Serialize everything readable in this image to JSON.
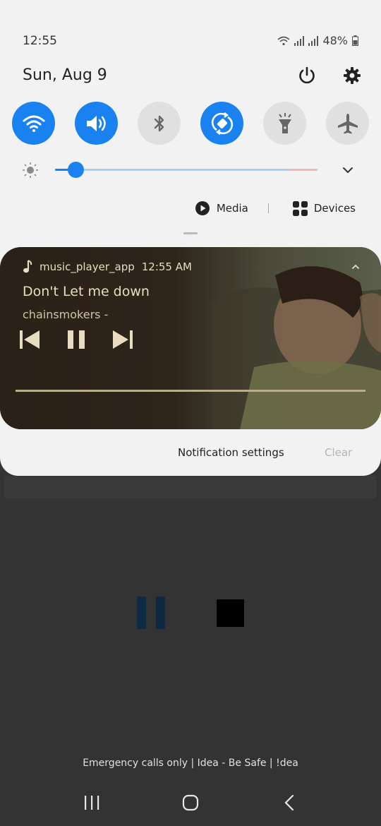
{
  "status_bar": {
    "time": "12:55",
    "battery": "48%",
    "icons": [
      "wifi-icon",
      "signal-icon",
      "signal-icon",
      "battery-icon"
    ]
  },
  "header": {
    "date": "Sun, Aug 9",
    "power_icon": "power-icon",
    "settings_icon": "gear-icon"
  },
  "quick_toggles": [
    {
      "name": "wifi",
      "icon": "wifi-icon",
      "on": true
    },
    {
      "name": "sound",
      "icon": "speaker-icon",
      "on": true
    },
    {
      "name": "bluetooth",
      "icon": "bluetooth-icon",
      "on": false
    },
    {
      "name": "auto-rotate",
      "icon": "rotate-icon",
      "on": true
    },
    {
      "name": "flashlight",
      "icon": "flashlight-icon",
      "on": false
    },
    {
      "name": "airplane-mode",
      "icon": "airplane-icon",
      "on": false
    }
  ],
  "brightness": {
    "level": 0.08
  },
  "media_row": {
    "media_label": "Media",
    "devices_label": "Devices"
  },
  "notification": {
    "app_name": "music_player_app",
    "time": "12:55 AM",
    "title": "Don't Let me down",
    "artist": "chainsmokers -",
    "controls": [
      "previous-icon",
      "pause-icon",
      "next-icon"
    ]
  },
  "actions": {
    "settings_label": "Notification settings",
    "clear_label": "Clear"
  },
  "footer": {
    "emergency_text": "Emergency calls only | Idea - Be Safe | !dea"
  },
  "colors": {
    "accent": "#1a82f0",
    "panel_bg": "#f2f2f2",
    "screen_bg": "#333333",
    "notif_text": "#e8dcc0"
  }
}
